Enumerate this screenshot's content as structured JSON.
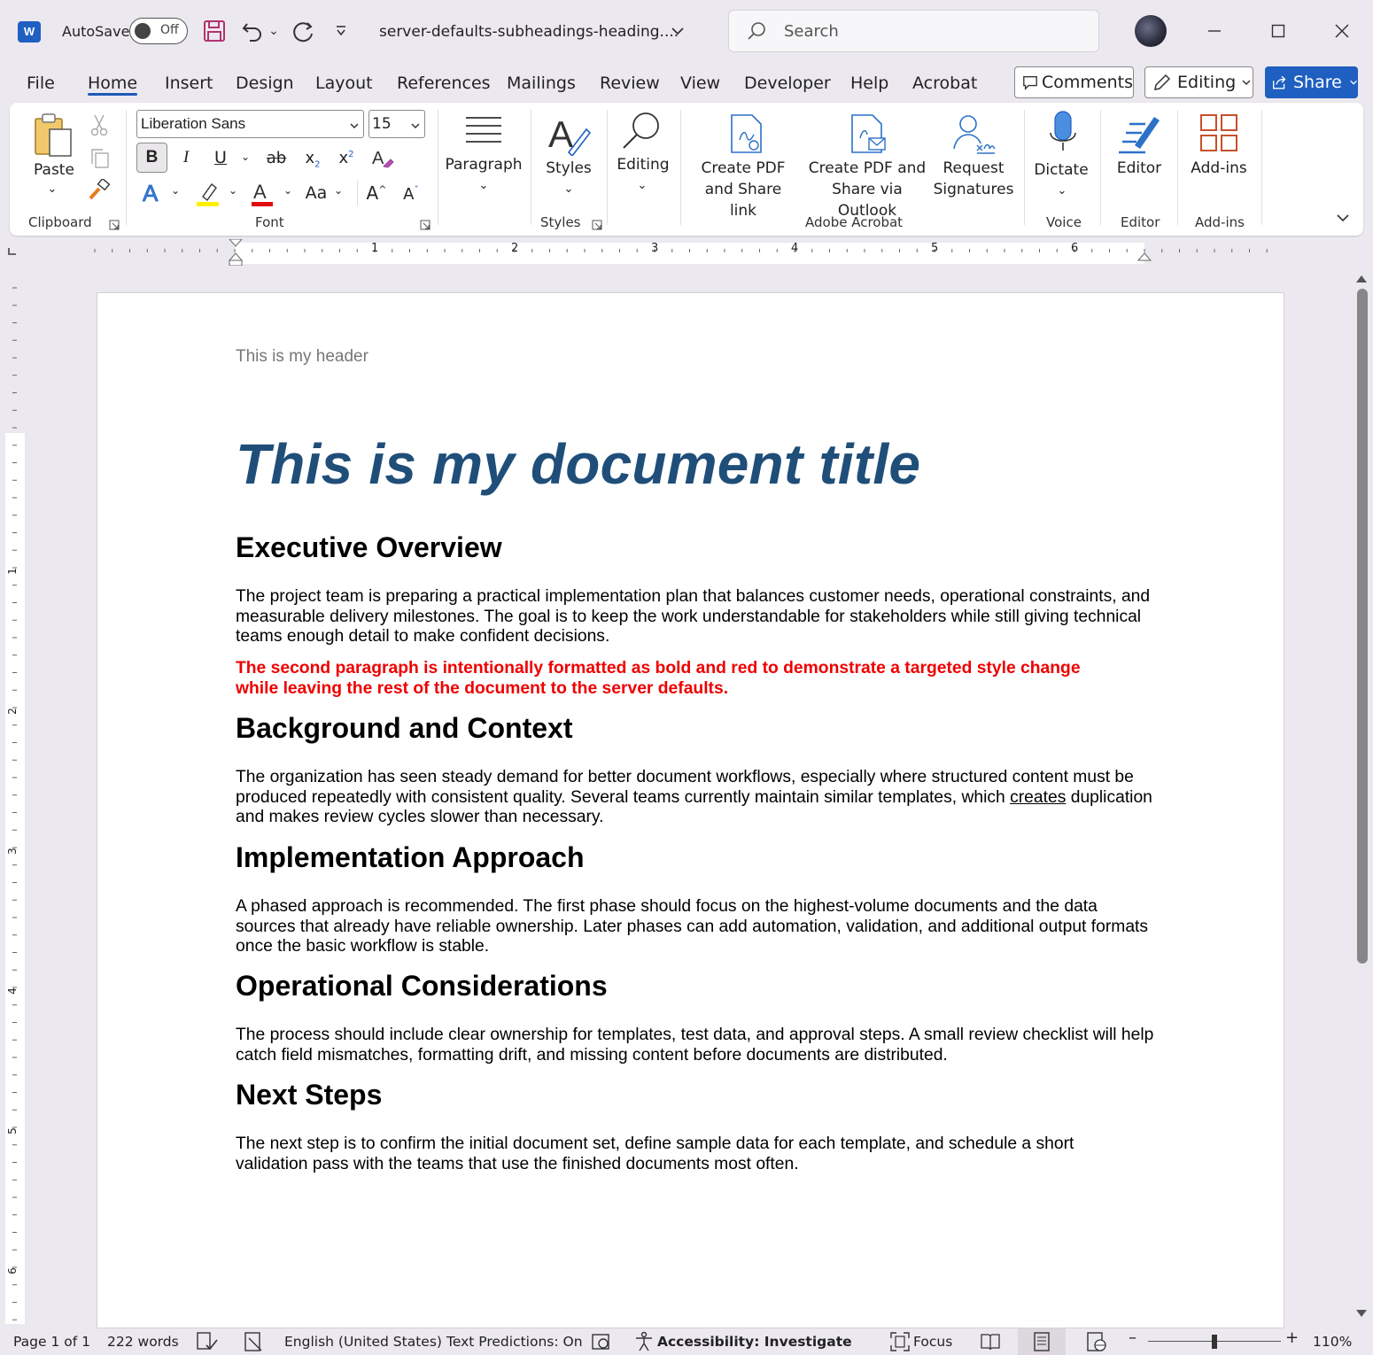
{
  "titlebar": {
    "app_logo": "W",
    "autosave_label": "AutoSave",
    "autosave_state": "Off",
    "document_name": "server-defaults-subheadings-heading....",
    "search_placeholder": "Search"
  },
  "menu": {
    "tabs": [
      "File",
      "Home",
      "Insert",
      "Design",
      "Layout",
      "References",
      "Mailings",
      "Review",
      "View",
      "Developer",
      "Help",
      "Acrobat"
    ],
    "active_tab": "Home",
    "comments_label": "Comments",
    "editing_label": "Editing",
    "share_label": "Share"
  },
  "ribbon": {
    "clipboard": {
      "paste_label": "Paste",
      "group_label": "Clipboard"
    },
    "font": {
      "font_name": "Liberation Sans",
      "font_size": "15",
      "group_label": "Font",
      "bold": "B",
      "italic": "I",
      "underline": "U",
      "strikethrough": "ab",
      "subscript": "x",
      "superscript": "x",
      "case": "Aa",
      "grow": "A",
      "shrink": "A"
    },
    "paragraph": {
      "label": "Paragraph"
    },
    "styles": {
      "label": "Styles",
      "group_label": "Styles"
    },
    "editing": {
      "label": "Editing"
    },
    "acrobat": {
      "create_share_link": "Create PDF and Share link",
      "create_share_outlook": "Create PDF and Share via Outlook",
      "request_signatures": "Request Signatures",
      "group_label": "Adobe Acrobat"
    },
    "voice": {
      "dictate_label": "Dictate",
      "group_label": "Voice"
    },
    "editor": {
      "label": "Editor",
      "group_label": "Editor"
    },
    "addins": {
      "label": "Add-ins",
      "group_label": "Add-ins"
    }
  },
  "ruler": {
    "numbers": [
      "1",
      "2",
      "3",
      "4",
      "5",
      "6"
    ]
  },
  "vruler": {
    "numbers": [
      "1",
      "2",
      "3",
      "4",
      "5",
      "6"
    ]
  },
  "document": {
    "header": "This is my header",
    "title": "This is my document title",
    "sections": [
      {
        "heading": "Executive Overview",
        "paragraphs": [
          "The project team is preparing a practical implementation plan that balances customer needs, operational constraints, and measurable delivery milestones. The goal is to keep the work understandable for stakeholders while still giving technical teams enough detail to make confident decisions.",
          "The second paragraph is intentionally formatted as bold and red to demonstrate a targeted style change while leaving the rest of the document to the server defaults."
        ]
      },
      {
        "heading": "Background and Context",
        "paragraph_before_link": "The organization has seen steady demand for better document workflows, especially where structured content must be produced repeatedly with consistent quality. Several teams currently maintain similar templates, which ",
        "link_word": "creates",
        "paragraph_after_link": " duplication and makes review cycles slower than necessary."
      },
      {
        "heading": "Implementation Approach",
        "paragraph": "A phased approach is recommended. The first phase should focus on the highest-volume documents and the data sources that already have reliable ownership. Later phases can add automation, validation, and additional output formats once the basic workflow is stable."
      },
      {
        "heading": "Operational Considerations",
        "paragraph": "The process should include clear ownership for templates, test data, and approval steps. A small review checklist will help catch field mismatches, formatting drift, and missing content before documents are distributed."
      },
      {
        "heading": "Next Steps",
        "paragraph": "The next step is to confirm the initial document set, define sample data for each template, and schedule a short validation pass with the teams that use the finished documents most often."
      }
    ]
  },
  "statusbar": {
    "page": "Page 1 of 1",
    "words": "222 words",
    "language": "English (United States)",
    "text_predictions": "Text Predictions: On",
    "accessibility": "Accessibility: Investigate",
    "focus": "Focus",
    "zoom": "110%"
  },
  "colors": {
    "title": "#1f4e79",
    "accent": "#1f5fc1",
    "red_text": "#ee0000",
    "acrobat_icon": "#2b71c8",
    "addins_icon": "#c8502b"
  }
}
